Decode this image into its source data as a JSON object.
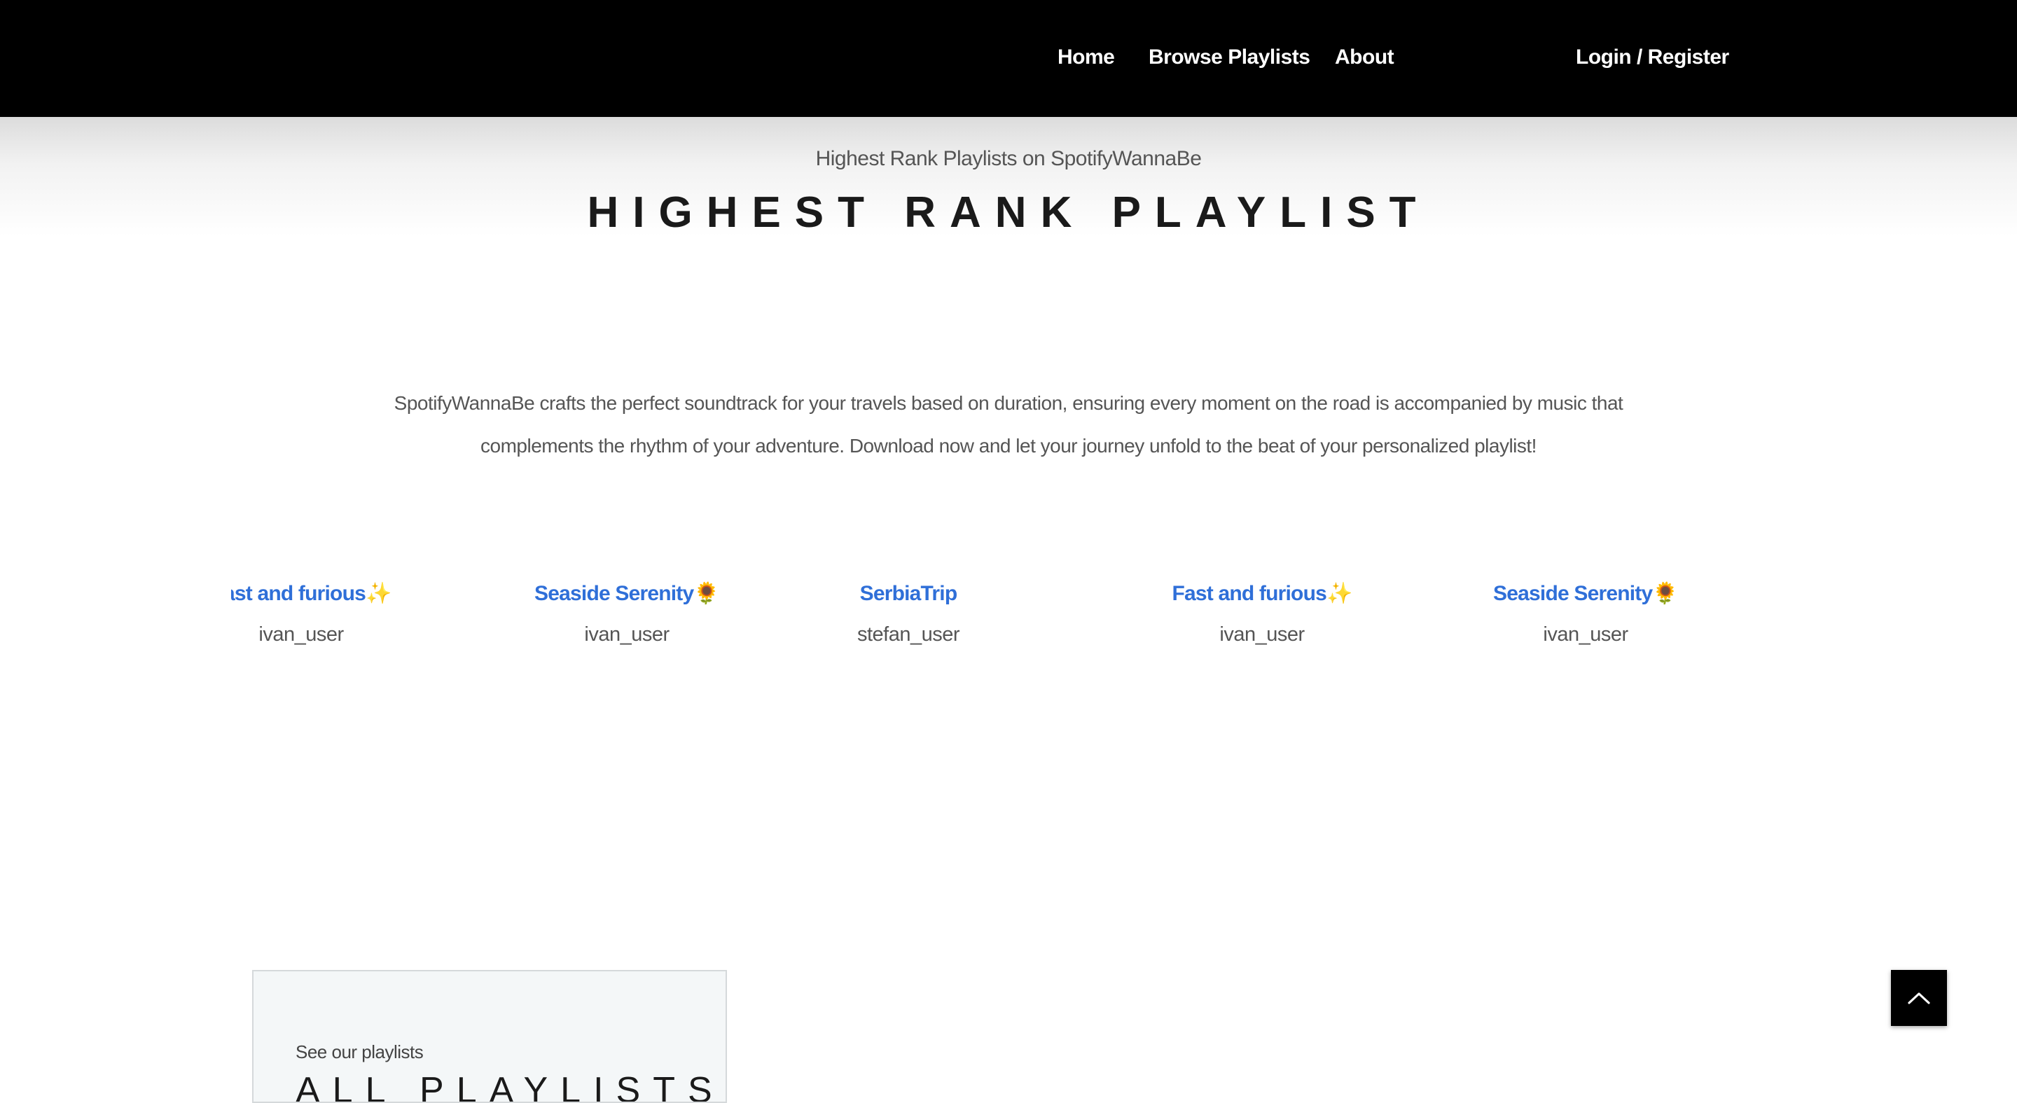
{
  "nav": {
    "items": [
      {
        "label": "Home"
      },
      {
        "label": "Browse Playlists"
      },
      {
        "label": "About"
      }
    ],
    "login_label": "Login / Register"
  },
  "hero": {
    "subtitle": "Highest Rank Playlists on SpotifyWannaBe",
    "title": "HIGHEST RANK PLAYLIST"
  },
  "description": "SpotifyWannaBe crafts the perfect soundtrack for your travels based on duration, ensuring every moment on the road is accompanied by music that complements the rhythm of your adventure. Download now and let your journey unfold to the beat of your personalized playlist!",
  "carousel": {
    "cards": [
      {
        "title": "Fast and furious",
        "emoji": "✨",
        "user": "ivan_user"
      },
      {
        "title": "Seaside Serenity",
        "emoji": "🌻",
        "user": "ivan_user"
      },
      {
        "title": "SerbiaTrip",
        "emoji": "",
        "user": "stefan_user"
      },
      {
        "title": "Fast and furious",
        "emoji": "✨",
        "user": "ivan_user"
      },
      {
        "title": "Seaside Serenity",
        "emoji": "🌻",
        "user": "ivan_user"
      }
    ]
  },
  "playlists_section": {
    "subtitle": "See our playlists",
    "title": "ALL PLAYLISTS"
  },
  "scroll_top": {
    "icon": "chevron-up-icon"
  },
  "colors": {
    "navbar": "#000000",
    "accent_link": "#2f6fd8",
    "text": "#555555"
  }
}
